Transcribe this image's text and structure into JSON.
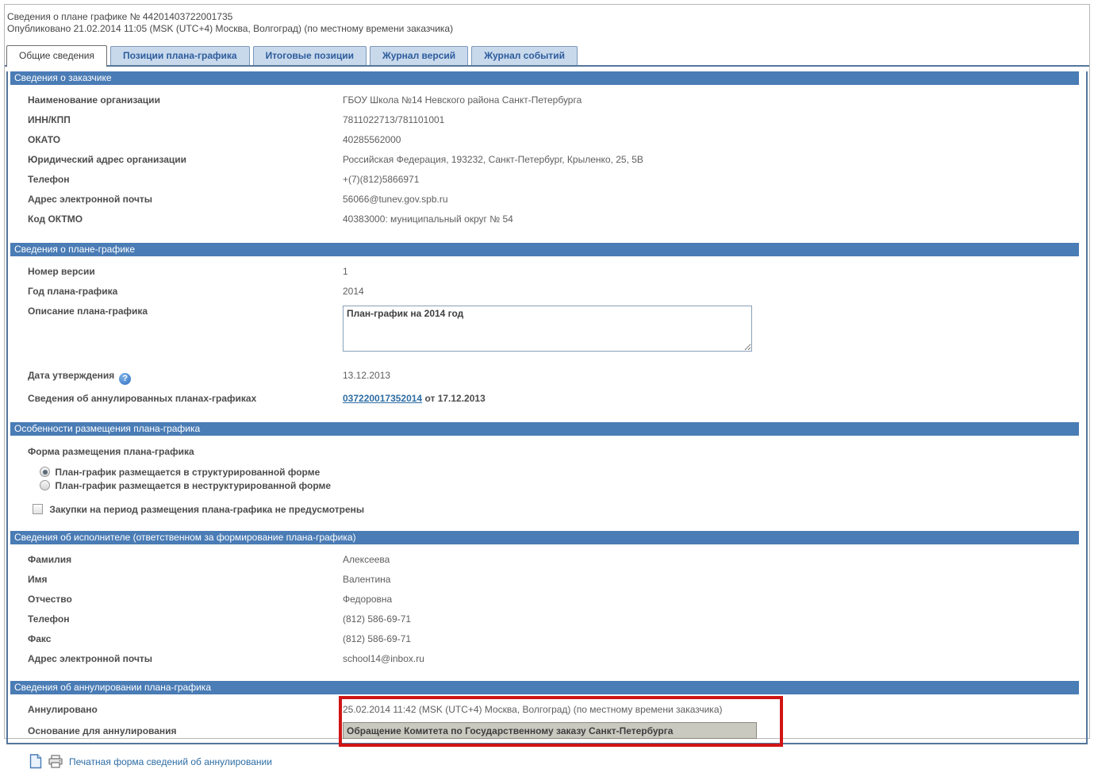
{
  "header": {
    "title": "Сведения о плане графике № 44201403722001735",
    "published": "Опубликовано 21.02.2014 11:05 (MSK (UTC+4) Москва, Волгоград) (по местному времени заказчика)"
  },
  "tabs": {
    "general": "Общие сведения",
    "positions": "Позиции плана-графика",
    "totals": "Итоговые позиции",
    "versions": "Журнал версий",
    "events": "Журнал событий"
  },
  "customer": {
    "title": "Сведения о заказчике",
    "org_name": {
      "label": "Наименование организации",
      "value": "ГБОУ Школа №14 Невского района Санкт-Петербурга"
    },
    "inn_kpp": {
      "label": "ИНН/КПП",
      "value": "7811022713/781101001"
    },
    "okato": {
      "label": "ОКАТО",
      "value": "40285562000"
    },
    "address": {
      "label": "Юридический адрес организации",
      "value": "Российская Федерация, 193232, Санкт-Петербург, Крыленко, 25, 5В"
    },
    "phone": {
      "label": "Телефон",
      "value": "+(7)(812)5866971"
    },
    "email": {
      "label": "Адрес электронной почты",
      "value": "56066@tunev.gov.spb.ru"
    },
    "oktmo": {
      "label": "Код ОКТМО",
      "value": "40383000: муниципальный округ № 54"
    }
  },
  "plan": {
    "title": "Сведения о плане-графике",
    "version": {
      "label": "Номер версии",
      "value": "1"
    },
    "year": {
      "label": "Год плана-графика",
      "value": "2014"
    },
    "description": {
      "label": "Описание плана-графика",
      "value": "План-график на 2014 год"
    },
    "approval_date": {
      "label": "Дата утверждения",
      "value": "13.12.2013"
    },
    "annulled_plans": {
      "label": "Сведения об аннулированных планах-графиках",
      "link": "037220017352014",
      "suffix": "от 17.12.2013"
    }
  },
  "placement": {
    "title": "Особенности размещения плана-графика",
    "form_label": "Форма размещения плана-графика",
    "radio_structured": "План-график размещается в структурированной форме",
    "radio_unstructured": "План-график размещается в неструктурированной форме",
    "checkbox_no_purchases": "Закупки на период размещения плана-графика не предусмотрены"
  },
  "executor": {
    "title": "Сведения об исполнителе (ответственном за формирование плана-графика)",
    "last_name": {
      "label": "Фамилия",
      "value": "Алексеева"
    },
    "first_name": {
      "label": "Имя",
      "value": "Валентина"
    },
    "middle_name": {
      "label": "Отчество",
      "value": "Федоровна"
    },
    "phone": {
      "label": "Телефон",
      "value": "(812) 586-69-71"
    },
    "fax": {
      "label": "Факс",
      "value": "(812) 586-69-71"
    },
    "email": {
      "label": "Адрес электронной почты",
      "value": "school14@inbox.ru"
    }
  },
  "annulment": {
    "title": "Сведения об аннулировании плана-графика",
    "annulled": {
      "label": "Аннулировано",
      "value": "25.02.2014 11:42 (MSK (UTC+4) Москва, Волгоград) (по местному времени заказчика)"
    },
    "reason": {
      "label": "Основание для аннулирования",
      "value": "Обращение Комитета по Государственному заказу Санкт-Петербурга"
    },
    "print_link": "Печатная форма сведений об аннулировании"
  },
  "icons": {
    "help": "help-icon",
    "document": "document-icon",
    "printer": "printer-icon"
  },
  "colors": {
    "section_bar": "#4a7cb5",
    "panel_border": "#54769b",
    "tab_inactive_bg": "#c9d9ec",
    "tab_inactive_text": "#2c5c9c",
    "link": "#2e6da4",
    "highlight_border": "#d01515",
    "disabled_input_bg": "#c9c9c0"
  }
}
